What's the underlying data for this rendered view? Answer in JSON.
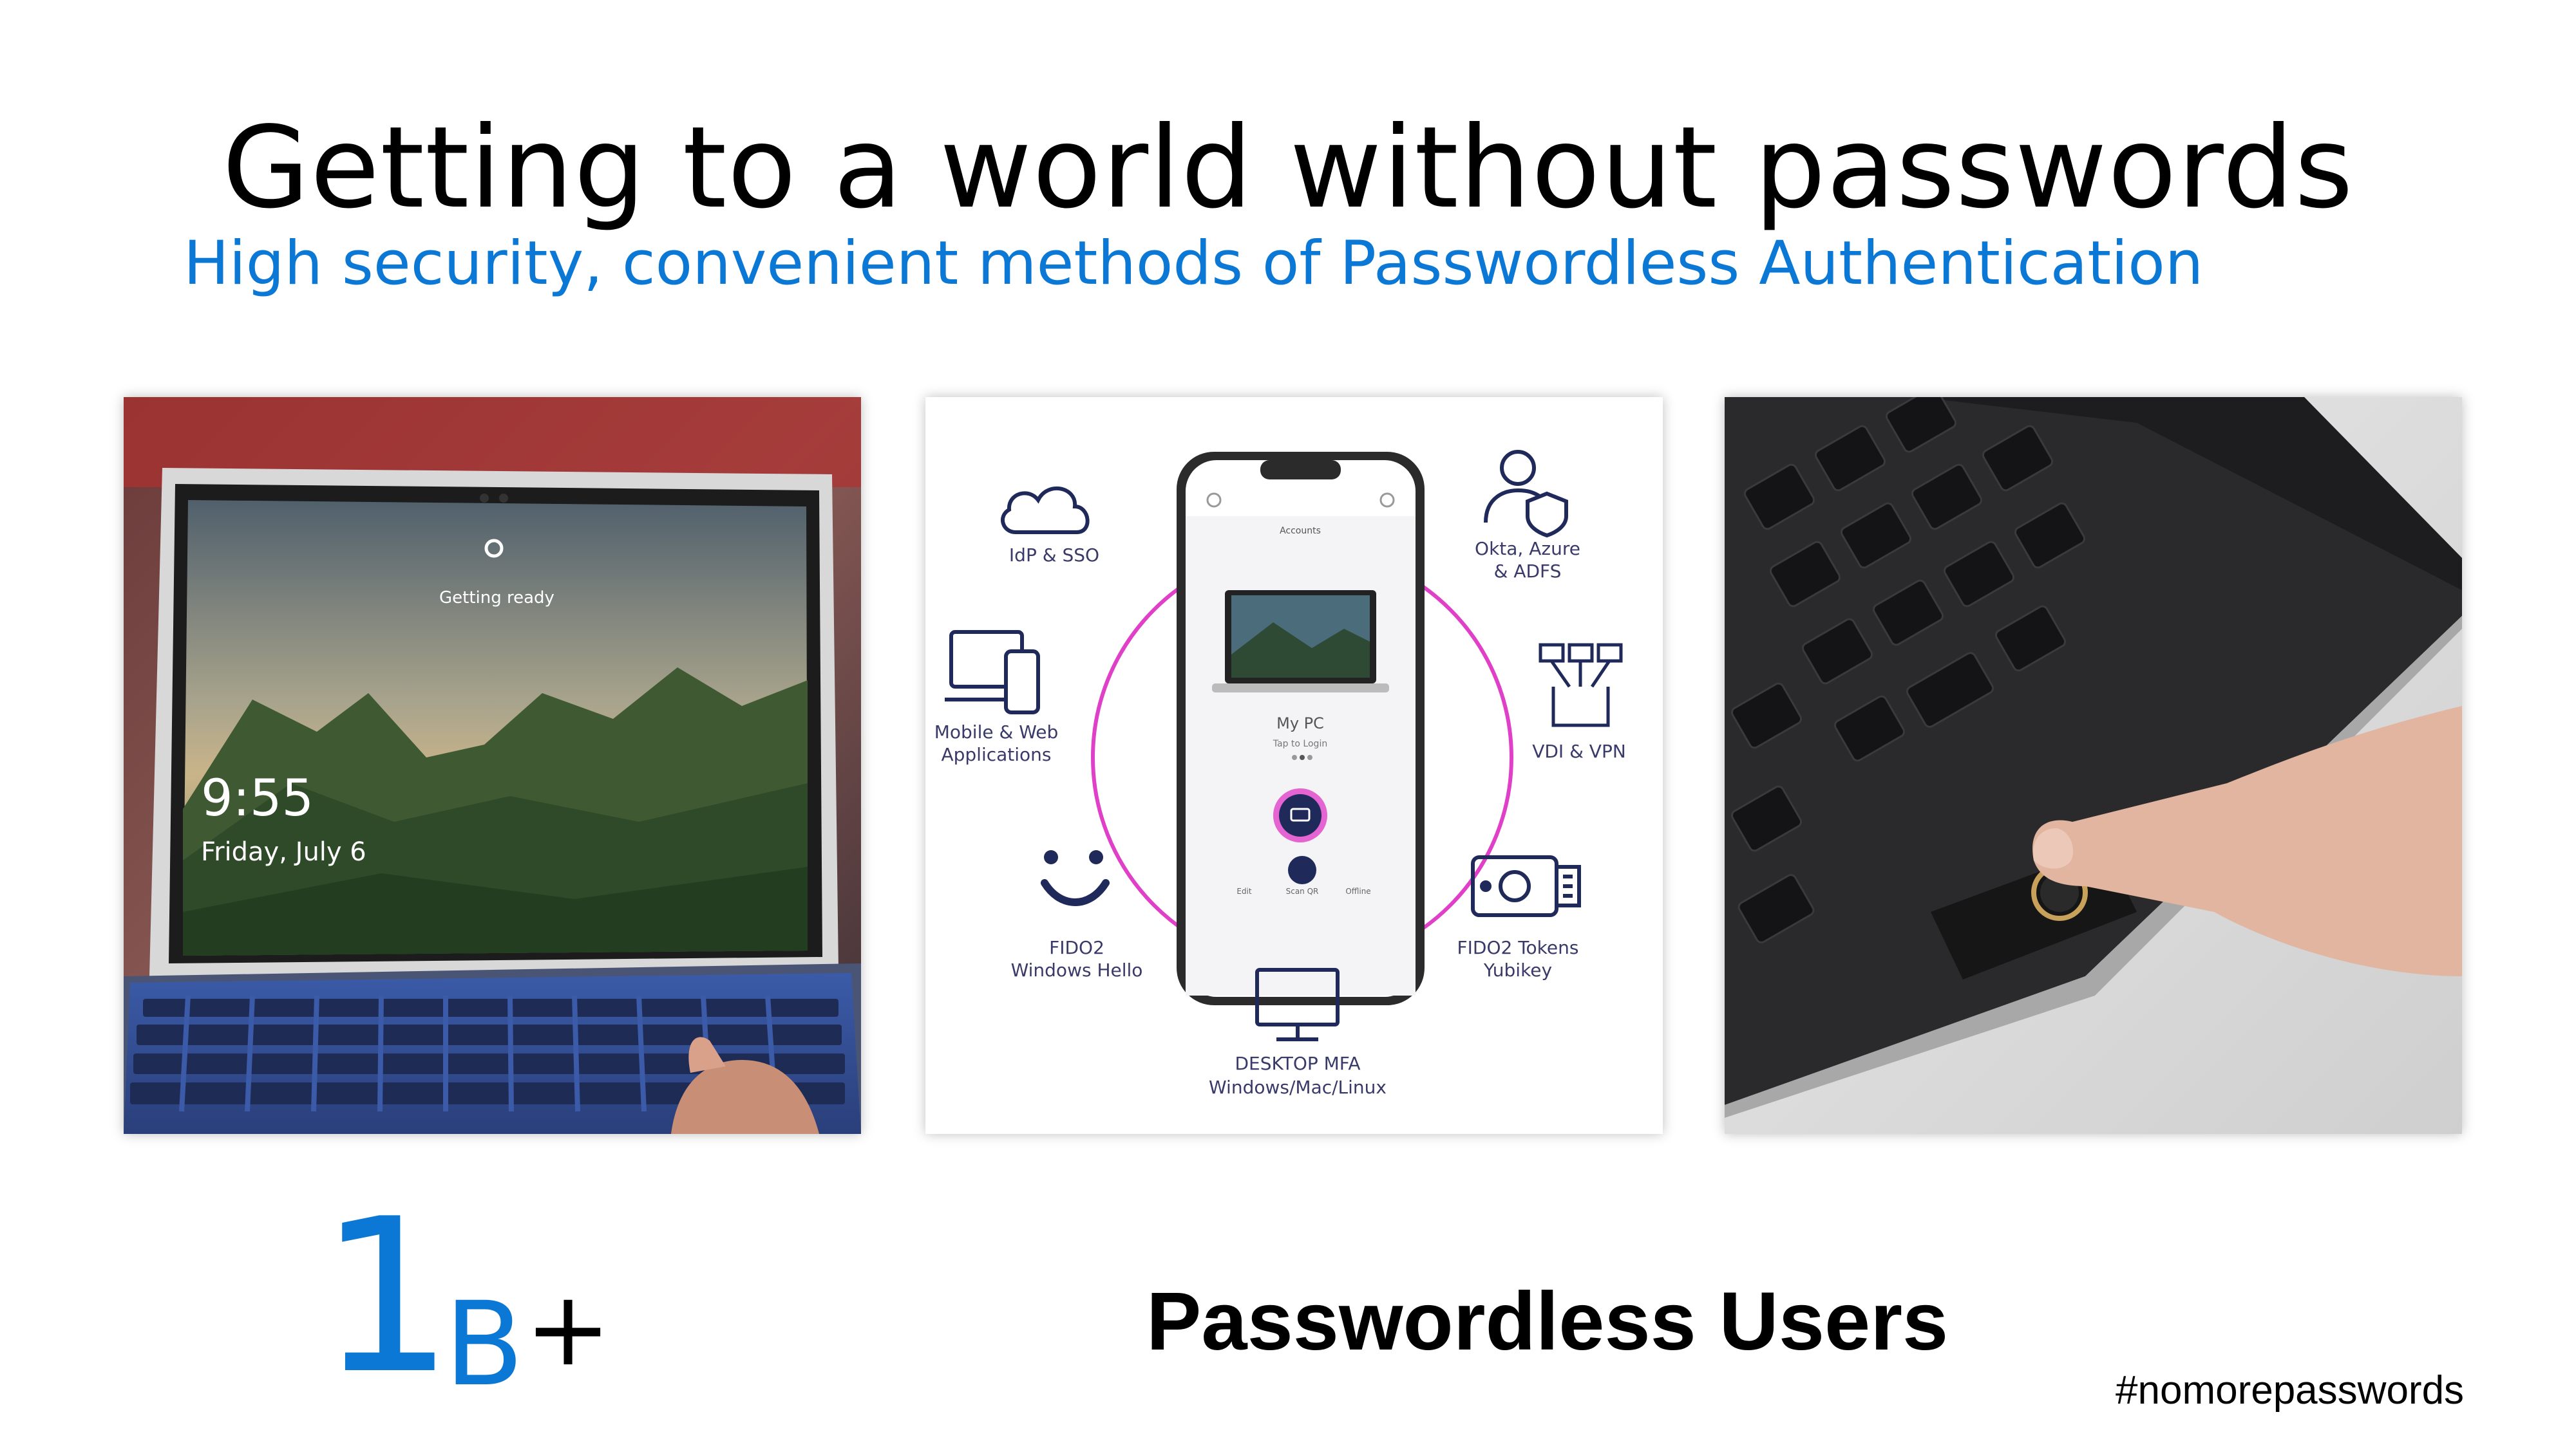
{
  "slide": {
    "title": "Getting to a world without passwords",
    "subtitle": "High security, convenient methods of Passwordless Authentication"
  },
  "photo_left": {
    "time": "9:55",
    "date": "Friday, July 6",
    "status_text": "Getting ready"
  },
  "diagram": {
    "phone": {
      "tab_label": "Accounts",
      "device_name": "My PC",
      "device_hint": "Tap to Login",
      "action_edit": "Edit",
      "action_scan": "Scan QR",
      "action_offline": "Offline"
    },
    "labels": {
      "idp_sso": "IdP & SSO",
      "okta_line1": "Okta, Azure",
      "okta_line2": "& ADFS",
      "mobile_line1": "Mobile & Web",
      "mobile_line2": "Applications",
      "vdi_vpn": "VDI & VPN",
      "fido2_hello_line1": "FIDO2",
      "fido2_hello_line2": "Windows Hello",
      "fido2_tokens_line1": "FIDO2 Tokens",
      "fido2_tokens_line2": "Yubikey",
      "desktop_line1": "DESKTOP MFA",
      "desktop_line2": "Windows/Mac/Linux"
    },
    "accent_color": "#e040c8",
    "text_color": "#3a3a6a"
  },
  "stat": {
    "number": "1",
    "unit": "B",
    "suffix": "+",
    "label": "Passwordless Users"
  },
  "hashtag": "#nomorepasswords",
  "colors": {
    "accent": "#0a78d4"
  }
}
